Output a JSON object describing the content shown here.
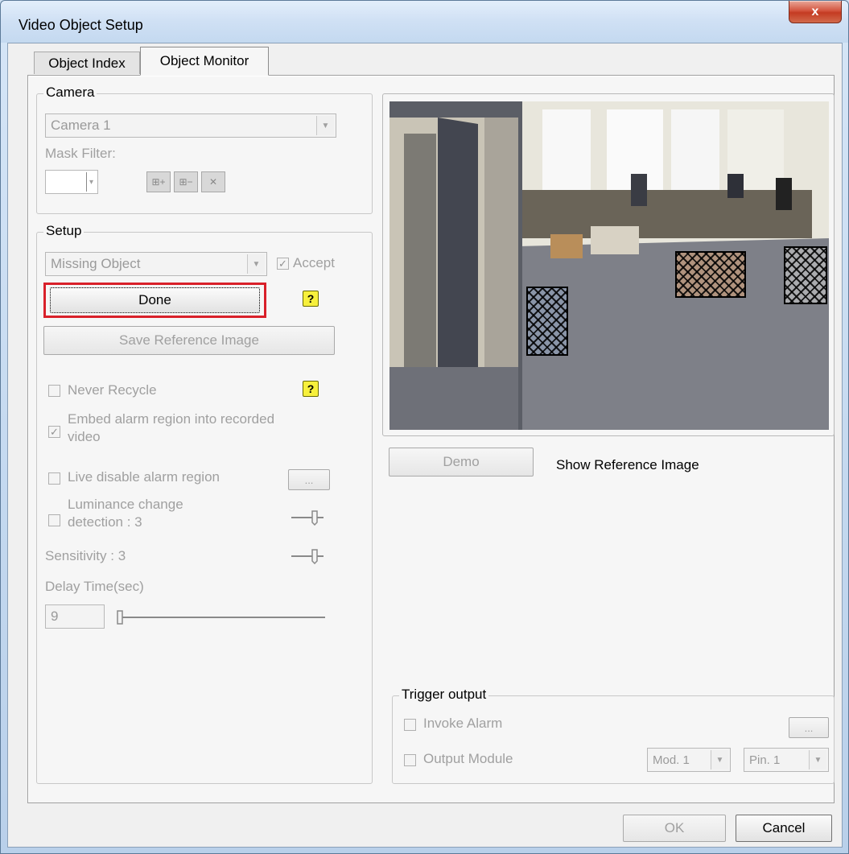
{
  "window": {
    "title": "Video Object Setup",
    "close_label": "x"
  },
  "tabs": [
    {
      "label": "Object Index"
    },
    {
      "label": "Object Monitor"
    }
  ],
  "camera": {
    "legend": "Camera",
    "selected": "Camera 1",
    "mask_filter_label": "Mask Filter:",
    "mask_filter_value": ""
  },
  "setup": {
    "legend": "Setup",
    "type_selected": "Missing Object",
    "accept_label": "Accept",
    "done_label": "Done",
    "save_reference_label": "Save Reference Image",
    "never_recycle_label": "Never Recycle",
    "embed_alarm_label_line1": "Embed alarm region into recorded",
    "embed_alarm_label_line2": "video",
    "live_disable_label": "Live disable alarm region",
    "ellipsis": "...",
    "luminance_line1": "Luminance change",
    "luminance_line2": "detection : 3",
    "sensitivity_label": "Sensitivity : 3",
    "delay_label": "Delay Time(sec)",
    "delay_value": "9",
    "help_glyph": "?"
  },
  "preview": {
    "demo_label": "Demo",
    "show_reference_label": "Show Reference Image"
  },
  "trigger": {
    "legend": "Trigger output",
    "invoke_alarm_label": "Invoke Alarm",
    "output_module_label": "Output Module",
    "module_selected": "Mod. 1",
    "pin_selected": "Pin. 1",
    "ellipsis": "..."
  },
  "footer": {
    "ok_label": "OK",
    "cancel_label": "Cancel"
  },
  "colors": {
    "highlight_border": "#d9202a",
    "help_icon": "#f7f03c"
  }
}
